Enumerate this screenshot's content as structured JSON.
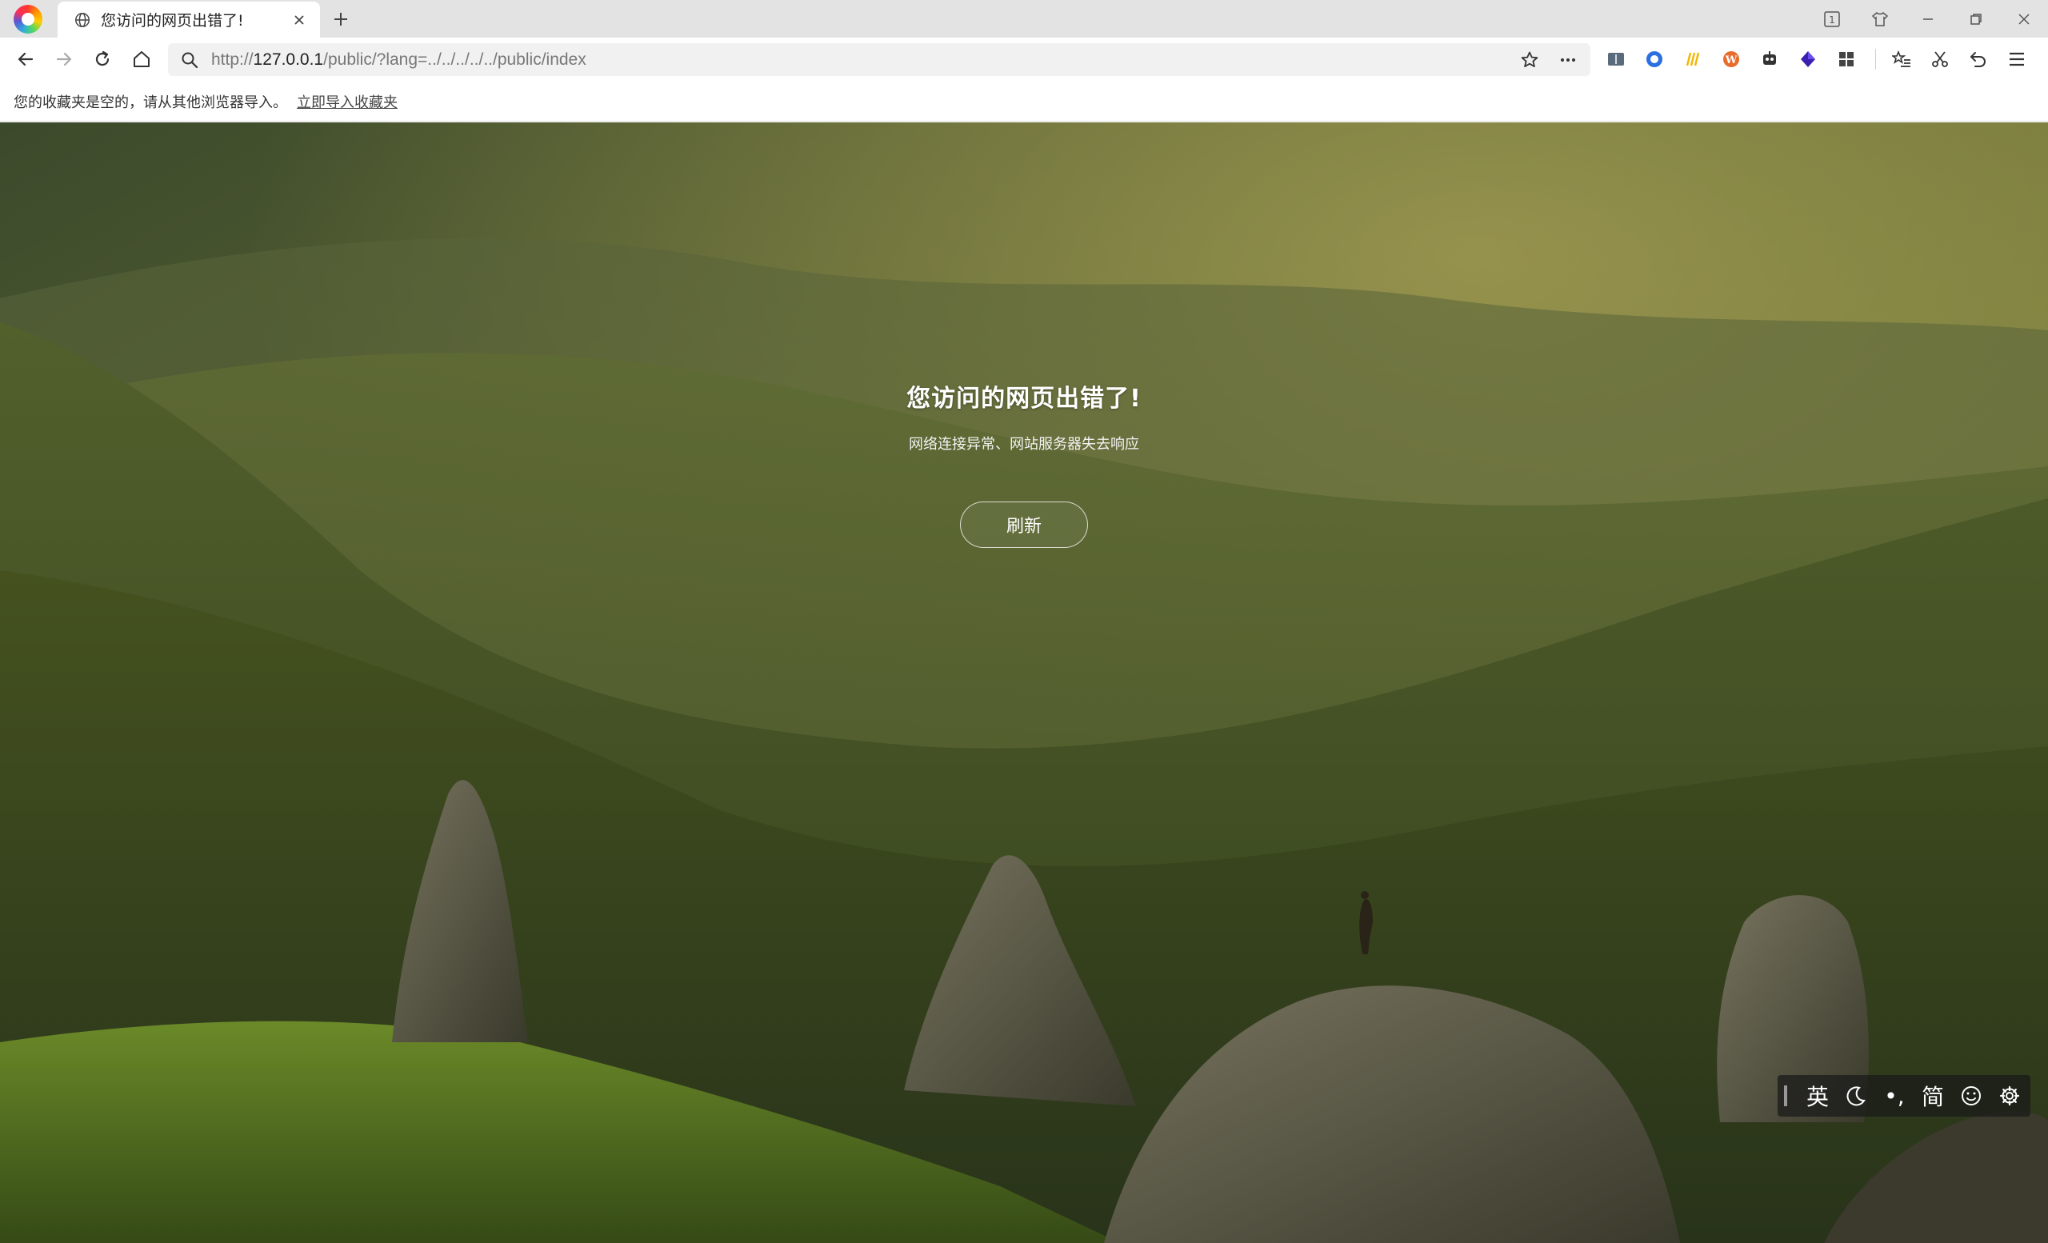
{
  "browser": {
    "tab": {
      "title": "您访问的网页出错了!",
      "close_icon": "close-icon",
      "favicon": "globe-icon"
    },
    "new_tab_icon": "plus-icon",
    "window_controls": [
      "tab-count-icon",
      "skin-icon",
      "minimize-icon",
      "restore-icon",
      "close-icon"
    ],
    "tab_count": "1"
  },
  "navbar": {
    "url_prefix": "http://",
    "url_host": "127.0.0.1",
    "url_path": "/public/?lang=../../../../../public/index",
    "extensions": [
      "reader-icon",
      "circle-icon",
      "stripes-icon",
      "wordpress-icon",
      "robot-icon",
      "cube-icon",
      "apps-icon",
      "favorites-icon",
      "scissors-icon",
      "undo-icon",
      "menu-icon"
    ]
  },
  "bookmarks_bar": {
    "empty_text": "您的收藏夹是空的，请从其他浏览器导入。",
    "import_link": "立即导入收藏夹"
  },
  "page": {
    "error_title": "您访问的网页出错了!",
    "error_subtitle": "网络连接异常、网站服务器失去响应",
    "refresh_button": "刷新"
  },
  "ime_toolbar": {
    "lang": "英",
    "punct": "•,",
    "charset": "简"
  },
  "colors": {
    "tabstrip": "#e3e3e3",
    "addressbar": "#f1f1f1",
    "scene_dark": "#3f4a22",
    "scene_light": "#7e8a3e"
  }
}
